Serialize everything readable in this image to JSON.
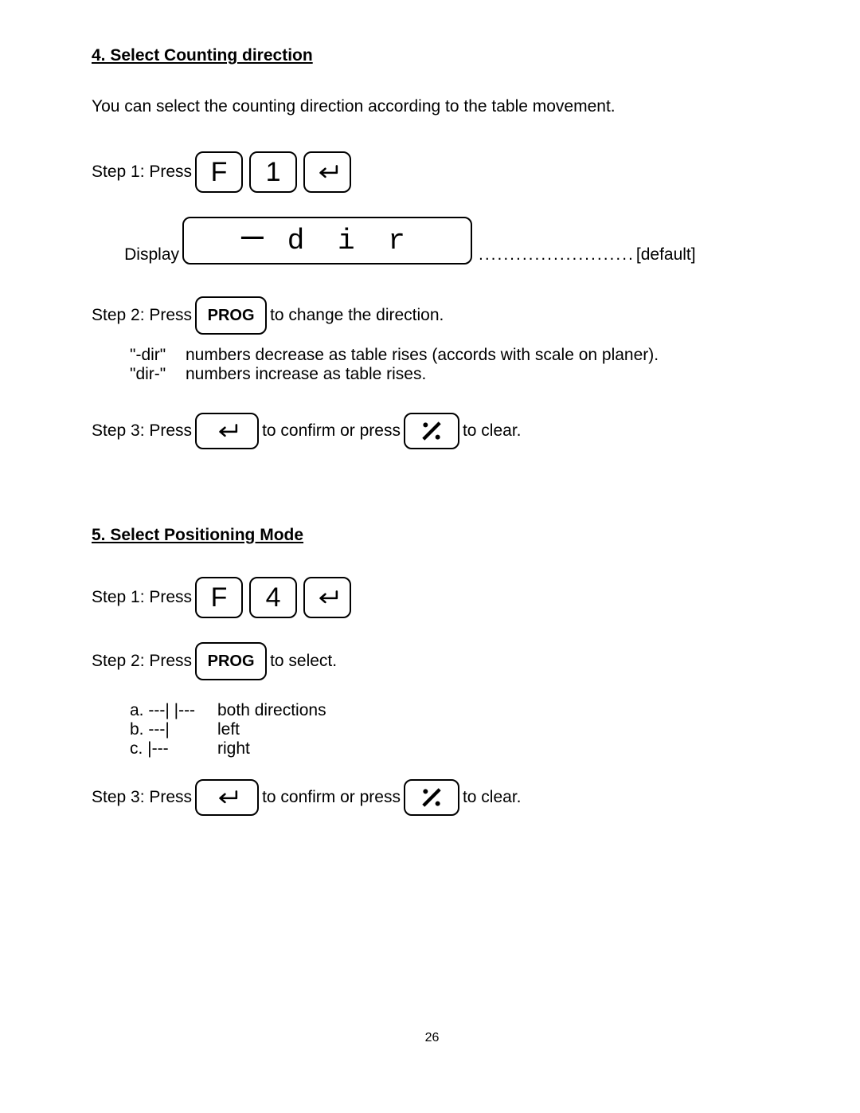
{
  "sec4": {
    "heading": "4. Select Counting direction",
    "intro": "You can select the counting direction according to the table movement.",
    "step1_label": "Step 1: Press",
    "key_F": "F",
    "key_1": "1",
    "display_label": "Display",
    "display_value": "d i r",
    "dots": ".........................",
    "default": "[default]",
    "step2_label": "Step 2: Press",
    "key_prog": "PROG",
    "step2_after": " to change the direction.",
    "defA_term": "\"-dir\"",
    "defA_desc": "numbers decrease as table rises (accords with scale on planer).",
    "defB_term": "\"dir-\"",
    "defB_desc": "numbers increase as table rises.",
    "step3_label": "Step 3: Press",
    "step3_mid": " to confirm or press",
    "step3_after": " to clear."
  },
  "sec5": {
    "heading": "5. Select Positioning Mode",
    "step1_label": "Step 1: Press",
    "key_F": "F",
    "key_4": "4",
    "step2_label": "Step 2: Press",
    "key_prog": "PROG",
    "step2_after": " to select.",
    "modeA_opt": "a. ---| |---",
    "modeA_desc": "both directions",
    "modeB_opt": "b. ---|",
    "modeB_desc": "left",
    "modeC_opt": "c. |---",
    "modeC_desc": "right",
    "step3_label": "Step 3: Press",
    "step3_mid": " to confirm or press",
    "step3_after": " to clear."
  },
  "page_number": "26"
}
